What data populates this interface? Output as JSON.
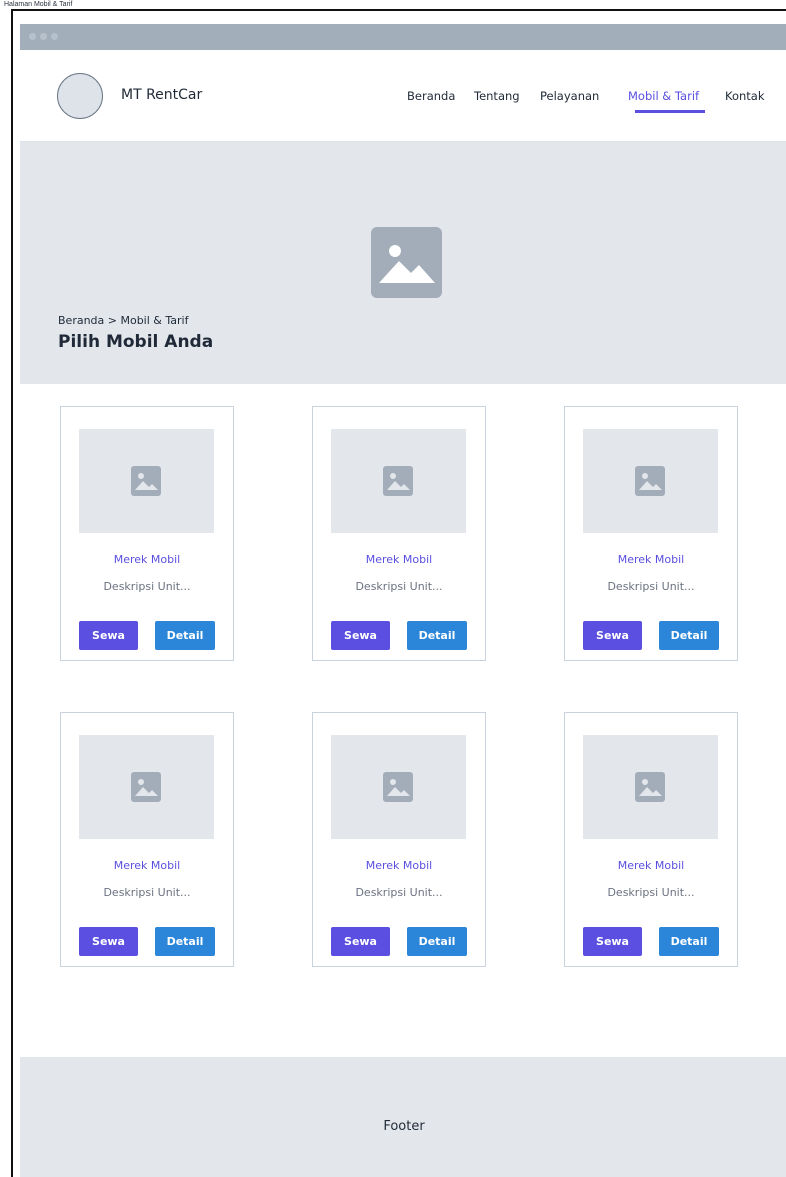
{
  "window": {
    "title": "Halaman Mobil & Tarif"
  },
  "header": {
    "brand": "MT RentCar",
    "nav": [
      {
        "label": "Beranda",
        "active": false
      },
      {
        "label": "Tentang",
        "active": false
      },
      {
        "label": "Pelayanan",
        "active": false
      },
      {
        "label": "Mobil & Tarif",
        "active": true
      },
      {
        "label": "Kontak",
        "active": false
      }
    ]
  },
  "hero": {
    "breadcrumb": "Beranda > Mobil & Tarif",
    "title": "Pilih Mobil Anda",
    "image_icon": "image-icon"
  },
  "cards": [
    {
      "title": "Merek Mobil",
      "description": "Deskripsi Unit...",
      "rent_label": "Sewa",
      "detail_label": "Detail"
    },
    {
      "title": "Merek Mobil",
      "description": "Deskripsi Unit...",
      "rent_label": "Sewa",
      "detail_label": "Detail"
    },
    {
      "title": "Merek Mobil",
      "description": "Deskripsi Unit...",
      "rent_label": "Sewa",
      "detail_label": "Detail"
    },
    {
      "title": "Merek Mobil",
      "description": "Deskripsi Unit...",
      "rent_label": "Sewa",
      "detail_label": "Detail"
    },
    {
      "title": "Merek Mobil",
      "description": "Deskripsi Unit...",
      "rent_label": "Sewa",
      "detail_label": "Detail"
    },
    {
      "title": "Merek Mobil",
      "description": "Deskripsi Unit...",
      "rent_label": "Sewa",
      "detail_label": "Detail"
    }
  ],
  "footer": {
    "label": "Footer"
  },
  "colors": {
    "accent": "#5a4fe0",
    "detail_button": "#2b86d9",
    "placeholder": "#e3e7ec",
    "placeholder_icon": "#a2adb9"
  }
}
